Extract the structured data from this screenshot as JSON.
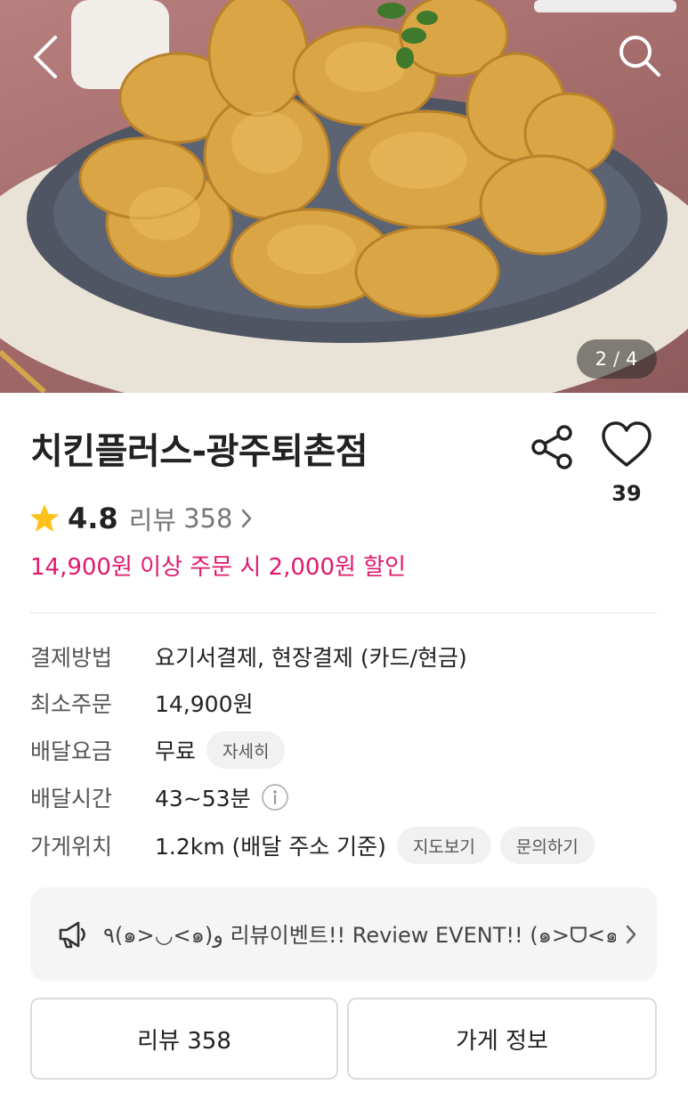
{
  "hero": {
    "counter_current": "2",
    "counter_separator": "/",
    "counter_total": "4"
  },
  "store": {
    "name": "치킨플러스-광주퇴촌점",
    "likes": "39",
    "rating": "4.8",
    "review_label": "리뷰",
    "review_count": "358",
    "promo": "14,900원 이상 주문 시 2,000원 할인"
  },
  "info": {
    "payment_label": "결제방법",
    "payment_value": "요기서결제, 현장결제 (카드/현금)",
    "min_order_label": "최소주문",
    "min_order_value": "14,900원",
    "delivery_fee_label": "배달요금",
    "delivery_fee_value": "무료",
    "delivery_fee_detail": "자세히",
    "delivery_time_label": "배달시간",
    "delivery_time_value": "43~53분",
    "location_label": "가게위치",
    "location_value": "1.2km (배달 주소 기준)",
    "map_button": "지도보기",
    "inquiry_button": "문의하기"
  },
  "event": {
    "text": "٩(๑>◡<๑)و 리뷰이벤트!! Review EVENT!! (๑>ᗜ<๑)..."
  },
  "tabs": {
    "review": "리뷰 358",
    "store_info": "가게 정보"
  },
  "colors": {
    "accent": "#e0196e",
    "star": "#ffc21a"
  },
  "icons": {
    "back": "chevron-left-icon",
    "search": "search-icon",
    "share": "share-icon",
    "like": "heart-icon",
    "star": "star-icon",
    "info": "info-icon",
    "megaphone": "megaphone-icon"
  }
}
